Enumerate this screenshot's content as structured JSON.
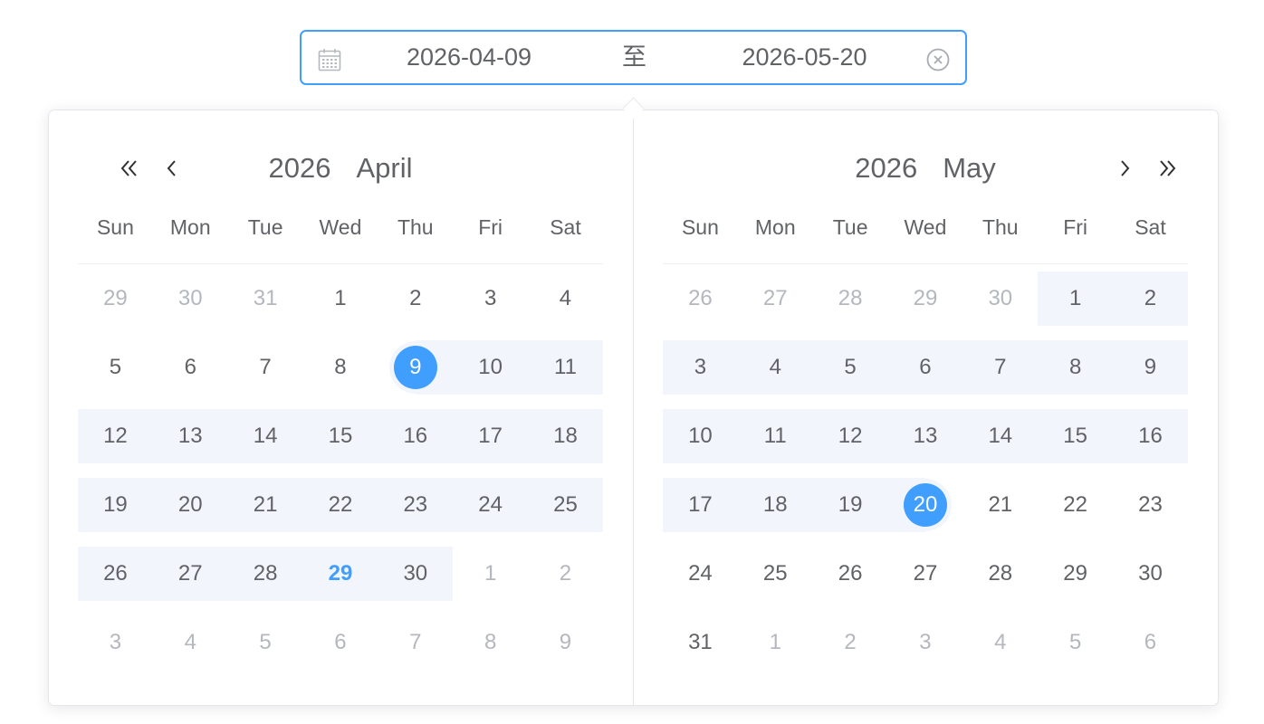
{
  "input": {
    "start_value": "2026-04-09",
    "separator": "至",
    "end_value": "2026-05-20",
    "calendar_icon": "calendar-icon",
    "clear_icon": "circle-close-icon"
  },
  "colors": {
    "accent": "#409eff",
    "range_bg": "#f2f6fc",
    "text": "#606266",
    "muted": "#b4b7bd"
  },
  "weekdays": [
    "Sun",
    "Mon",
    "Tue",
    "Wed",
    "Thu",
    "Fri",
    "Sat"
  ],
  "left_panel": {
    "year": "2026",
    "month": "April",
    "nav_icons": [
      "double-chevron-left-icon",
      "chevron-left-icon"
    ],
    "days": [
      [
        "29",
        "30",
        "31",
        "1",
        "2",
        "3",
        "4"
      ],
      [
        "5",
        "6",
        "7",
        "8",
        "9",
        "10",
        "11"
      ],
      [
        "12",
        "13",
        "14",
        "15",
        "16",
        "17",
        "18"
      ],
      [
        "19",
        "20",
        "21",
        "22",
        "23",
        "24",
        "25"
      ],
      [
        "26",
        "27",
        "28",
        "29",
        "30",
        "1",
        "2"
      ],
      [
        "3",
        "4",
        "5",
        "6",
        "7",
        "8",
        "9"
      ]
    ]
  },
  "right_panel": {
    "year": "2026",
    "month": "May",
    "nav_icons": [
      "chevron-right-icon",
      "double-chevron-right-icon"
    ],
    "days": [
      [
        "26",
        "27",
        "28",
        "29",
        "30",
        "1",
        "2"
      ],
      [
        "3",
        "4",
        "5",
        "6",
        "7",
        "8",
        "9"
      ],
      [
        "10",
        "11",
        "12",
        "13",
        "14",
        "15",
        "16"
      ],
      [
        "17",
        "18",
        "19",
        "20",
        "21",
        "22",
        "23"
      ],
      [
        "24",
        "25",
        "26",
        "27",
        "28",
        "29",
        "30"
      ],
      [
        "31",
        "1",
        "2",
        "3",
        "4",
        "5",
        "6"
      ]
    ]
  }
}
